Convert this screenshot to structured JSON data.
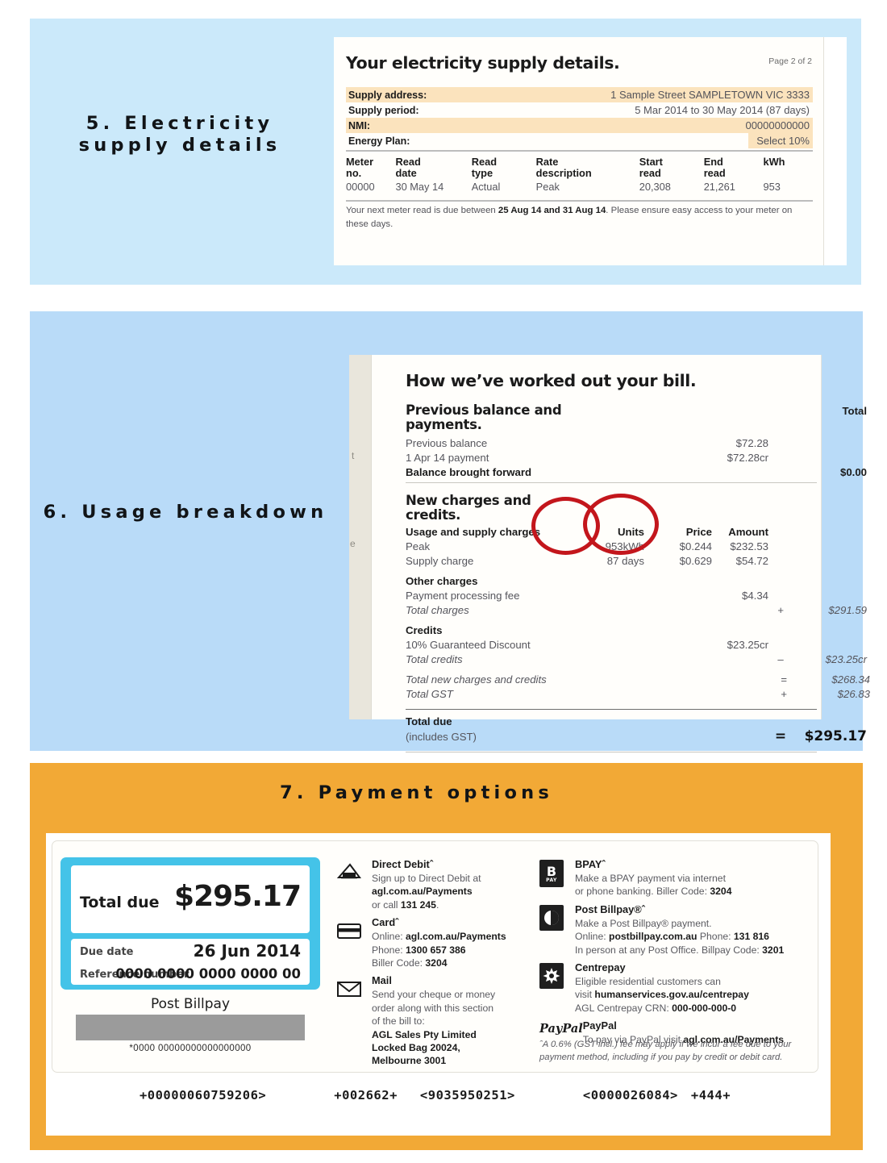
{
  "colors": {
    "panel5_bg": "#cbe9fa",
    "panel6_bg": "#b9dbf8",
    "panel7_bg": "#f2a936",
    "stub_border": "#44c3e8",
    "annotation_circle": "#c3161c",
    "highlight": "#fbe3bd"
  },
  "sections": {
    "five": {
      "heading": "5. Electricity\nsupply details"
    },
    "six": {
      "heading": "6. Usage breakdown"
    },
    "seven": {
      "heading": "7. Payment options"
    }
  },
  "supply_details": {
    "title": "Your electricity supply details.",
    "page_label": "Page 2 of 2",
    "rows": [
      {
        "label": "Supply address:",
        "value": "1 Sample Street SAMPLETOWN VIC 3333",
        "highlight": true
      },
      {
        "label": "Supply period:",
        "value": "5 Mar 2014 to 30 May 2014 (87 days)",
        "highlight": false
      },
      {
        "label": "NMI:",
        "value": "00000000000",
        "highlight": true
      },
      {
        "label": "Energy Plan:",
        "value": "Select 10%",
        "highlight": false
      }
    ],
    "meter_table": {
      "headers": [
        "Meter no.",
        "Read date",
        "Read type",
        "Rate description",
        "Start read",
        "End read",
        "kWh"
      ],
      "headers_line1": [
        "Meter",
        "Read",
        "Read",
        "Rate",
        "Start",
        "End",
        "kWh"
      ],
      "headers_line2": [
        "no.",
        "date",
        "type",
        "description",
        "read",
        "read",
        ""
      ],
      "rows": [
        [
          "00000",
          "30 May 14",
          "Actual",
          "Peak",
          "20,308",
          "21,261",
          "953"
        ]
      ]
    },
    "note_pre": "Your next meter read is due between ",
    "note_bold": "25 Aug 14 and 31 Aug 14",
    "note_post": ". Please ensure easy access to your meter on these days."
  },
  "bill_breakdown": {
    "title": "How we’ve worked out your bill.",
    "ghost_text_1": "t",
    "ghost_text_2": "e",
    "previous": {
      "subtitle": "Previous balance and payments.",
      "total_header": "Total",
      "rows": [
        {
          "desc": "Previous balance",
          "amount": "$72.28"
        },
        {
          "desc": "1 Apr 14 payment",
          "amount": "$72.28cr"
        }
      ],
      "brought_forward_label": "Balance brought forward",
      "brought_forward_value": "$0.00"
    },
    "new_charges": {
      "subtitle": "New charges and credits.",
      "usage_header": {
        "desc": "Usage and supply charges",
        "units": "Units",
        "price": "Price",
        "amount": "Amount"
      },
      "usage_rows": [
        {
          "desc": "Peak",
          "units": "953kWh",
          "price": "$0.244",
          "amount": "$232.53"
        },
        {
          "desc": "Supply charge",
          "units": "87 days",
          "price": "$0.629",
          "amount": "$54.72"
        }
      ],
      "other_header": "Other charges",
      "other_rows": [
        {
          "desc": "Payment processing fee",
          "amount": "$4.34"
        }
      ],
      "total_charges_label": "Total charges",
      "total_charges_sign": "+",
      "total_charges_value": "$291.59",
      "credits_header": "Credits",
      "credit_rows": [
        {
          "desc": "10% Guaranteed Discount",
          "amount": "$23.25cr"
        }
      ],
      "total_credits_label": "Total credits",
      "total_credits_sign": "–",
      "total_credits_value": "$23.25cr",
      "total_new_label": "Total new charges and credits",
      "total_new_sign": "=",
      "total_new_value": "$268.34",
      "total_gst_label": "Total GST",
      "total_gst_sign": "+",
      "total_gst_value": "$26.83",
      "total_due_label": "Total due",
      "total_due_sub": "(includes GST)",
      "total_due_sign": "=",
      "total_due_value": "$295.17"
    }
  },
  "payment": {
    "stub": {
      "total_due_label": "Total due",
      "total_due_value": "$295.17",
      "due_date_label": "Due date",
      "due_date_value": "26 Jun 2014",
      "reference_label": "Reference number",
      "reference_value": "0000 0000 0000 0000 00",
      "post_billpay_label": "Post Billpay",
      "barcode_number": "*0000 00000000000000000"
    },
    "methods_middle": [
      {
        "icon": "direct-debit-icon",
        "title": "Direct Debitˆ",
        "lines": [
          {
            "text": "Sign up to Direct Debit at",
            "bold": false
          },
          {
            "text": "agl.com.au/Payments",
            "bold": true
          },
          {
            "text": "or call ",
            "bold": false,
            "bold_tail": "131 245",
            "tail": "."
          }
        ]
      },
      {
        "icon": "card-icon",
        "title": "Cardˆ",
        "lines": [
          {
            "text": "Online: ",
            "bold": false,
            "bold_tail": "agl.com.au/Payments"
          },
          {
            "text": "Phone: ",
            "bold": false,
            "bold_tail": "1300 657 386"
          },
          {
            "text": "Biller Code: ",
            "bold": false,
            "bold_tail": "3204"
          }
        ]
      },
      {
        "icon": "mail-icon",
        "title": "Mail",
        "lines": [
          {
            "text": "Send your cheque or money",
            "bold": false
          },
          {
            "text": "order along with this section",
            "bold": false
          },
          {
            "text": "of the bill to:",
            "bold": false
          },
          {
            "text": "AGL Sales Pty Limited",
            "bold": true
          },
          {
            "text": "Locked Bag 20024,",
            "bold": true
          },
          {
            "text": "Melbourne 3001",
            "bold": true
          }
        ]
      }
    ],
    "methods_right": [
      {
        "icon": "bpay-icon",
        "title": "BPAYˆ",
        "lines": [
          {
            "text": "Make a BPAY payment via internet",
            "bold": false
          },
          {
            "text": "or phone banking. Biller Code: ",
            "bold": false,
            "bold_tail": "3204"
          }
        ]
      },
      {
        "icon": "post-billpay-icon",
        "title": "Post Billpay®ˆ",
        "lines": [
          {
            "text": "Make a Post Billpay® payment.",
            "bold": false
          },
          {
            "text": "Online: ",
            "bold": false,
            "bold_tail": "postbillpay.com.au",
            "tail2": "  Phone: ",
            "bold_tail2": "131 816"
          },
          {
            "text": "In person at any Post Office. Billpay Code: ",
            "bold": false,
            "bold_tail": "3201"
          }
        ]
      },
      {
        "icon": "centrepay-icon",
        "title": "Centrepay",
        "lines": [
          {
            "text": "Eligible residential customers can",
            "bold": false
          },
          {
            "text": "visit ",
            "bold": false,
            "bold_tail": "humanservices.gov.au/centrepay"
          },
          {
            "text": "AGL Centrepay CRN: ",
            "bold": false,
            "bold_tail": "000-000-000-0"
          }
        ]
      },
      {
        "icon": "paypal-icon",
        "title": "PayPal",
        "lines": [
          {
            "text": "To pay via PayPal visit ",
            "bold": false,
            "bold_tail": "agl.com.au/Payments"
          }
        ]
      }
    ],
    "footnote": "ˆA 0.6% (GST incl.) fee may apply if we incur a fee due to your payment method, including if you pay by credit or debit card.",
    "ocr_line": [
      "+00000060759206>",
      "+002662+",
      "<9035950251>",
      "<0000026084>",
      "+444+"
    ]
  }
}
